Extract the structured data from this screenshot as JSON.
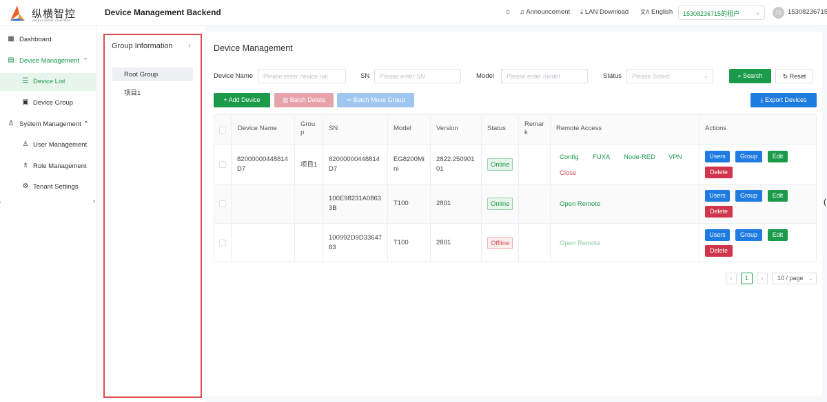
{
  "brand": {
    "name_cn": "纵横智控",
    "name_en": "INTELLIGENT CONTROL"
  },
  "header": {
    "title": "Device Management Backend",
    "announcement": "Announcement",
    "lan_download": "LAN Download",
    "language": "English",
    "tenant": "15308236715的租户",
    "avatar": "15",
    "user": "15308236715"
  },
  "sidebar": {
    "dashboard": "Dashboard",
    "device_management": "Device Management",
    "device_list": "Device List",
    "device_group": "Device Group",
    "system_management": "System Management",
    "user_management": "User Management",
    "role_management": "Role Management",
    "tenant_settings": "Tenant Settings"
  },
  "group_panel": {
    "title": "Group Information",
    "nodes": [
      "Root Group",
      "项目1"
    ]
  },
  "filters": {
    "title": "Device Management",
    "device_name_label": "Device Name",
    "device_name_placeholder": "Please enter device nar",
    "sn_label": "SN",
    "sn_placeholder": "Please enter SN",
    "model_label": "Model",
    "model_placeholder": "Please enter model",
    "status_label": "Status",
    "status_placeholder": "Please Select",
    "search": "Search",
    "reset": "Reset"
  },
  "toolbar": {
    "add": "+ Add Device",
    "batch_delete": "Batch Delete",
    "batch_move": "Batch Move Group",
    "export": "Export Devices"
  },
  "table": {
    "columns": {
      "device_name": "Device Name",
      "group": [
        "Grou",
        "p"
      ],
      "sn": "SN",
      "model": "Model",
      "version": "Version",
      "status": "Status",
      "remark": [
        "Remar",
        "k"
      ],
      "remote_access": "Remote Access",
      "actions": "Actions"
    },
    "rows": [
      {
        "name": [
          "82000000448814",
          "D7"
        ],
        "group": "项目1",
        "sn": [
          "82000000448814",
          "D7"
        ],
        "model": [
          "EG8200Mi",
          "ni"
        ],
        "version": [
          "2822.250901",
          "01"
        ],
        "status": "Online",
        "remote": [
          "Config",
          "FUXA",
          "Node-RED",
          "VPN"
        ],
        "remote_close": "Close"
      },
      {
        "name": [
          "",
          ""
        ],
        "group": "",
        "sn": [
          "100E98231A0863",
          "3B"
        ],
        "model": [
          "T100",
          ""
        ],
        "version": [
          "2801",
          ""
        ],
        "status": "Online",
        "remote_open": "Open Remote"
      },
      {
        "name": [
          "",
          ""
        ],
        "group": "",
        "sn": [
          "100992D9D33647",
          "83"
        ],
        "model": [
          "T100",
          ""
        ],
        "version": [
          "2801",
          ""
        ],
        "status": "Offline",
        "remote_open": "Open Remote"
      }
    ],
    "actions": {
      "users": "Users",
      "group": "Group",
      "edit": "Edit",
      "delete": "Delete"
    }
  },
  "pagination": {
    "prev": "‹",
    "page": "1",
    "next": "›",
    "page_size": "10 / page"
  },
  "colors": {
    "brand_green": "#1a9a4a",
    "action_blue": "#1e7be0",
    "danger_red": "#d0354d",
    "highlight_border": "#e04a4a"
  }
}
